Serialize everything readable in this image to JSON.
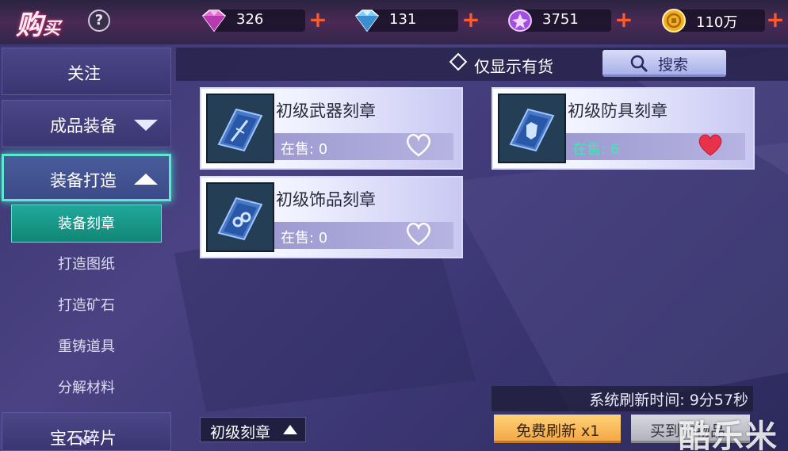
{
  "header": {
    "title_main": "购",
    "title_small": "买",
    "help_label": "?",
    "currencies": [
      {
        "icon": "pink-diamond-icon",
        "value": "326",
        "color": "#e86ad8"
      },
      {
        "icon": "blue-diamond-icon",
        "value": "131",
        "color": "#7ad0f8"
      },
      {
        "icon": "purple-crystal-icon",
        "value": "3751",
        "color": "#a24ee0"
      },
      {
        "icon": "gold-coin-icon",
        "value": "110万",
        "color": "#f4b020"
      }
    ],
    "plus_label": "+"
  },
  "sidebar": {
    "follow": "关注",
    "finished_gear": "成品装备",
    "crafting": "装备打造",
    "sub_items": [
      "装备刻章",
      "打造图纸",
      "打造矿石",
      "重铸道具",
      "分解材料"
    ],
    "selected_sub": 0,
    "partial_item": "宝石碎片"
  },
  "filter": {
    "in_stock_only": "仅显示有货",
    "search": "搜索"
  },
  "items": [
    {
      "name": "初级武器刻章",
      "stock": "在售: 0",
      "favorited": false,
      "in_stock": false
    },
    {
      "name": "初级防具刻章",
      "stock": "在售: 6",
      "favorited": true,
      "in_stock": true
    },
    {
      "name": "初级饰品刻章",
      "stock": "在售: 0",
      "favorited": false,
      "in_stock": false
    }
  ],
  "footer": {
    "tier_dropdown": "初级刻章",
    "refresh_time": "系统刷新时间: 9分57秒",
    "free_refresh": "免费刷新 x1",
    "bought_items": "买到的物品",
    "watermark": "酷乐米"
  },
  "colors": {
    "accent_teal": "#1fa89a",
    "heart_red": "#e8324a",
    "stock_green": "#3de8b4"
  }
}
